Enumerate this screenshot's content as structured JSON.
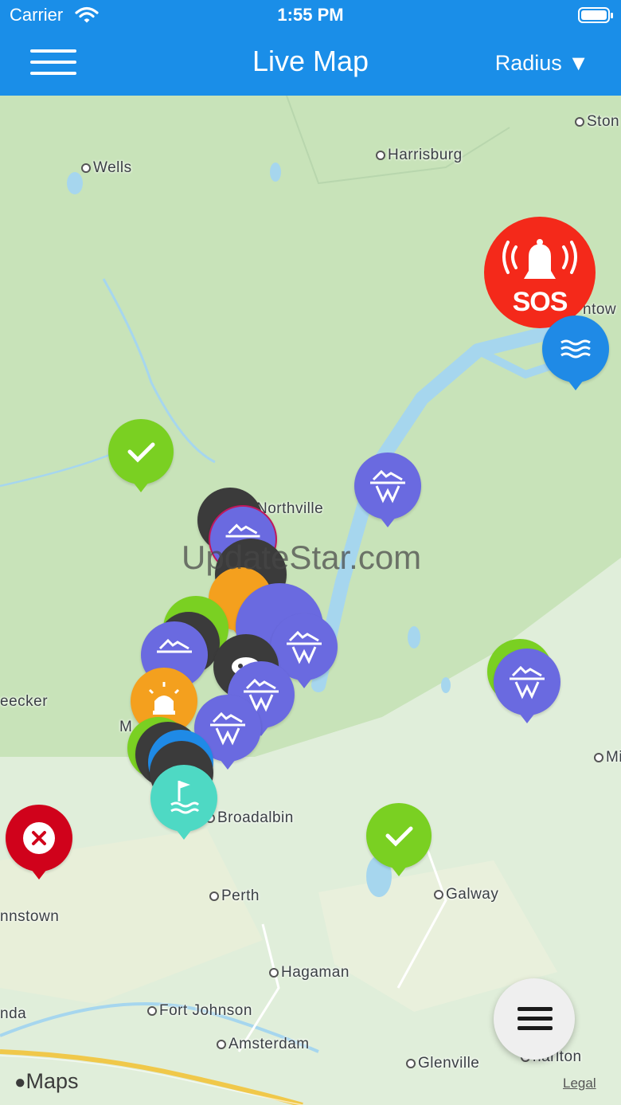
{
  "status_bar": {
    "carrier": "Carrier",
    "time": "1:55 PM"
  },
  "nav": {
    "title": "Live Map",
    "radius_label": "Radius ▼"
  },
  "map": {
    "towns": [
      {
        "name": "Ston"
      },
      {
        "name": "Harrisburg"
      },
      {
        "name": "Wells"
      },
      {
        "name": "ntow"
      },
      {
        "name": "Northville"
      },
      {
        "name": "eecker"
      },
      {
        "name": "M"
      },
      {
        "name": "Mi"
      },
      {
        "name": "Broadalbin"
      },
      {
        "name": "nnstown"
      },
      {
        "name": "Perth"
      },
      {
        "name": "Galway"
      },
      {
        "name": "Hagaman"
      },
      {
        "name": "nda"
      },
      {
        "name": "Fort Johnson"
      },
      {
        "name": "Amsterdam"
      },
      {
        "name": "Glenville"
      },
      {
        "name": "harlton"
      }
    ],
    "sos_label": "SOS",
    "watermark": "UpdateStar.com",
    "attribution": "Maps",
    "legal": "Legal"
  },
  "colors": {
    "nav_bar": "#1a8ee8",
    "sos": "#f4291a",
    "pin_iceberg": "#6a6ae0",
    "pin_check": "#7ad022",
    "pin_water": "#1f8ae6",
    "pin_alert": "#f4a01e",
    "pin_flood": "#4ed9c4",
    "pin_error": "#d0021b",
    "pin_dark": "#3b3b3b"
  },
  "pins": [
    {
      "icon": "check-icon"
    },
    {
      "icon": "waves-icon"
    },
    {
      "icon": "iceberg-icon"
    },
    {
      "icon": "iceberg-icon"
    },
    {
      "icon": "iceberg-icon"
    },
    {
      "icon": "iceberg-icon"
    },
    {
      "icon": "iceberg-icon"
    },
    {
      "icon": "iceberg-icon"
    },
    {
      "icon": "warning-light-icon"
    },
    {
      "icon": "flood-flag-icon"
    },
    {
      "icon": "close-icon"
    },
    {
      "icon": "check-icon"
    },
    {
      "icon": "mask-icon"
    }
  ],
  "fab": {
    "icon": "menu-icon"
  }
}
